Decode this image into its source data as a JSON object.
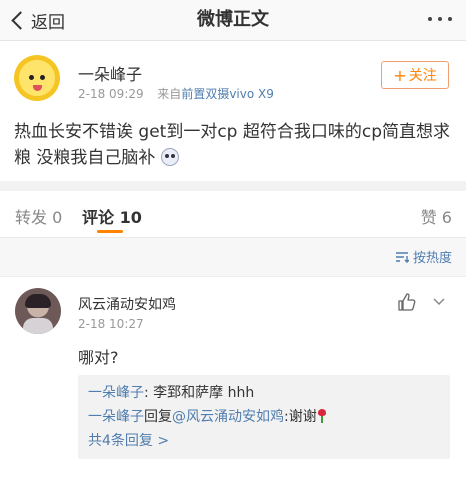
{
  "navbar": {
    "back_label": "返回",
    "title": "微博正文"
  },
  "post": {
    "author": "一朵峰子",
    "time": "2-18 09:29",
    "source_prefix": "来自",
    "source": "前置双摄vivo X9",
    "follow_label": "关注",
    "text": "热血长安不错诶 get到一对cp 超符合我口味的cp简直想求粮 没粮我自己脑补"
  },
  "tabs": {
    "repost": "转发 0",
    "comment": "评论 10",
    "like": "赞 6"
  },
  "sort": {
    "label": "按热度"
  },
  "comment": {
    "author": "风云涌动安如鸡",
    "time": "2-18 10:27",
    "text": "哪对?",
    "replies": [
      {
        "user": "一朵峰子",
        "sep": ": ",
        "text": "李郅和萨摩 hhh"
      },
      {
        "user": "一朵峰子",
        "verb": "回复",
        "mention": "@风云涌动安如鸡",
        "sep": ":",
        "text": "谢谢"
      }
    ],
    "more_replies": "共4条回复 >"
  },
  "colors": {
    "accent": "#ff8200",
    "link": "#507daf",
    "muted": "#999999"
  },
  "icons": [
    "back-chevron-icon",
    "more-dots-icon",
    "plus-icon",
    "sort-icon",
    "thumb-up-icon",
    "chevron-down-icon",
    "emoji-icon",
    "rose-icon"
  ]
}
